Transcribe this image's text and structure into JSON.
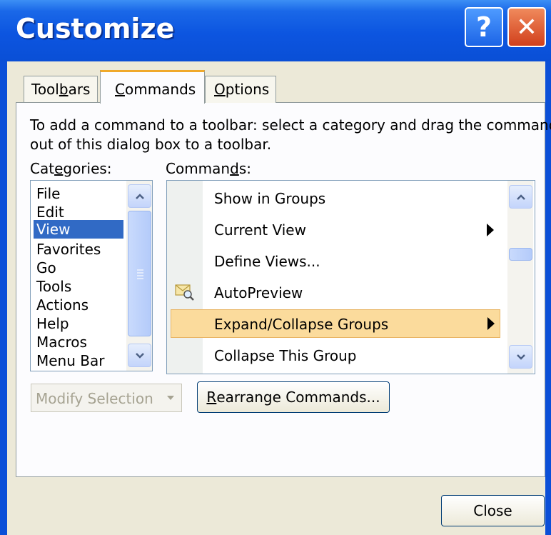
{
  "window": {
    "title": "Customize",
    "help_glyph": "?",
    "close_glyph": "✕"
  },
  "tabs": [
    {
      "pre": "Tool",
      "key": "b",
      "post": "ars",
      "active": false
    },
    {
      "pre": "",
      "key": "C",
      "post": "ommands",
      "active": true
    },
    {
      "pre": "",
      "key": "O",
      "post": "ptions",
      "active": false
    }
  ],
  "instruction": {
    "line1": "To add a command to a toolbar: select a category and drag the command",
    "line2": "out of this dialog box to a toolbar."
  },
  "categories_label": {
    "pre": "Cat",
    "key": "e",
    "post": "gories:"
  },
  "commands_label": {
    "pre": "Comman",
    "key": "d",
    "post": "s:"
  },
  "categories": {
    "items": [
      "File",
      "Edit",
      "View",
      "Favorites",
      "Go",
      "Tools",
      "Actions",
      "Help",
      "Macros",
      "Menu Bar"
    ],
    "selected": "View"
  },
  "commands": {
    "items": [
      {
        "label": "Show in Groups",
        "submenu": false,
        "highlighted": false,
        "icon": ""
      },
      {
        "label": "Current View",
        "submenu": true,
        "highlighted": false,
        "icon": ""
      },
      {
        "label": "Define Views...",
        "submenu": false,
        "highlighted": false,
        "icon": ""
      },
      {
        "label": "AutoPreview",
        "submenu": false,
        "highlighted": false,
        "icon": "envelope-magnifier-icon"
      },
      {
        "label": "Expand/Collapse Groups",
        "submenu": true,
        "highlighted": true,
        "icon": ""
      },
      {
        "label": "Collapse This Group",
        "submenu": false,
        "highlighted": false,
        "icon": ""
      }
    ]
  },
  "buttons": {
    "modify_selection": "Modify Selection",
    "rearrange": {
      "pre": "",
      "key": "R",
      "post": "earrange Commands..."
    },
    "close": "Close"
  },
  "colors": {
    "titlebar": "#0a4fd6",
    "dialog_face": "#ece9d8",
    "selection": "#316ac5",
    "highlight": "#fbdb9c"
  }
}
